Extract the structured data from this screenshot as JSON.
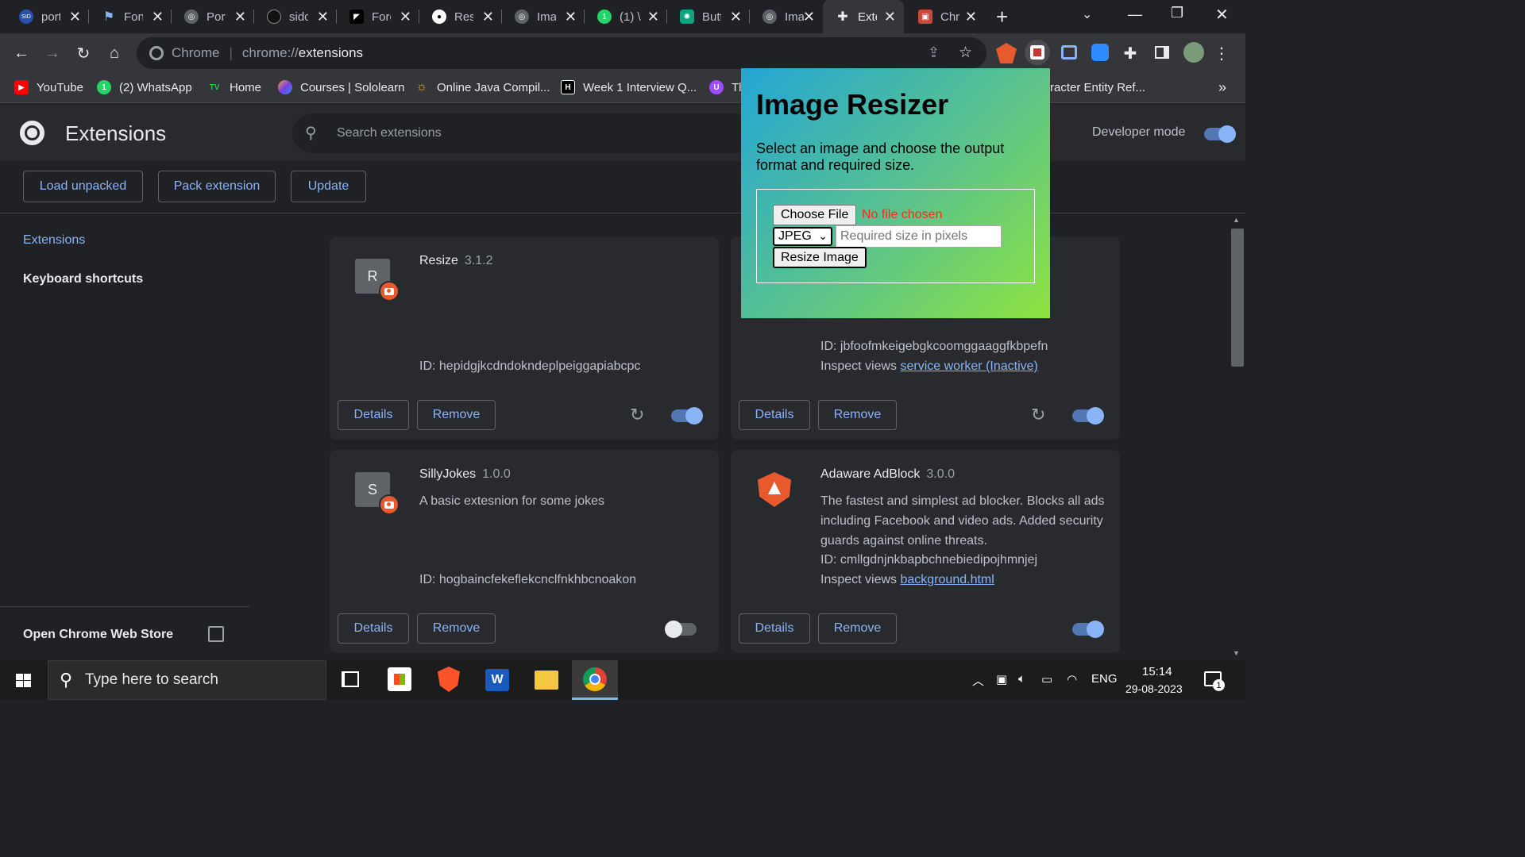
{
  "tabs": [
    {
      "label": "port",
      "fav": "SID",
      "favcolor": "#2a4fb0"
    },
    {
      "label": "Fon",
      "fav": "⚑",
      "favcolor": "#3c6fd8"
    },
    {
      "label": "Port",
      "fav": "◎",
      "favcolor": "#5f6368"
    },
    {
      "label": "sidc",
      "fav": "●",
      "favcolor": "#333333"
    },
    {
      "label": "Fore",
      "fav": "⬢",
      "favcolor": "#000000"
    },
    {
      "label": "Resi",
      "fav": "●",
      "favcolor": "#333333"
    },
    {
      "label": "Ima",
      "fav": "◎",
      "favcolor": "#5f6368"
    },
    {
      "label": "(1) \\",
      "fav": "1",
      "favcolor": "#25d366"
    },
    {
      "label": "Butt",
      "fav": "✺",
      "favcolor": "#10a37f"
    },
    {
      "label": "Ima",
      "fav": "◎",
      "favcolor": "#5f6368"
    },
    {
      "label": "Exte",
      "fav": "✚",
      "favcolor": "#35363a"
    },
    {
      "label": "Chr",
      "fav": "▣",
      "favcolor": "#c94a3d"
    }
  ],
  "omnibox": {
    "chip": "Chrome",
    "url_scheme": "chrome://",
    "url_path": "extensions"
  },
  "bookmarks": [
    {
      "label": "YouTube",
      "fav": "▶",
      "color": "#ff0000"
    },
    {
      "label": "(2) WhatsApp",
      "fav": "1",
      "color": "#25d366"
    },
    {
      "label": "Home",
      "fav": "TV",
      "color": "#2a9d4b"
    },
    {
      "label": "Courses | Sololearn",
      "fav": "S",
      "color": "#7b3fe4"
    },
    {
      "label": "Online Java Compil...",
      "fav": "☼",
      "color": "#e8a33d"
    },
    {
      "label": "Week 1 Interview Q...",
      "fav": "H",
      "color": "#111111"
    },
    {
      "label": "Tl",
      "fav": "U",
      "color": "#9b4dff"
    },
    {
      "label": "racter Entity Ref...",
      "fav": "",
      "color": "#35363a"
    }
  ],
  "header": {
    "title": "Extensions",
    "search_placeholder": "Search extensions",
    "dev_mode_label": "Developer mode",
    "dev_mode_on": true
  },
  "dev_buttons": {
    "load_unpacked": "Load unpacked",
    "pack": "Pack extension",
    "update": "Update"
  },
  "sidebar": {
    "extensions": "Extensions",
    "shortcuts": "Keyboard shortcuts",
    "web_store": "Open Chrome Web Store"
  },
  "cards": [
    {
      "letter": "R",
      "name": "Resize",
      "version": "3.1.2",
      "description": "",
      "id": "ID: hepidgjkcdndokndeplpeiggapiabcpc",
      "inspect_label": "",
      "inspect_link": "",
      "details": "Details",
      "remove": "Remove",
      "enabled": true
    },
    {
      "letter": "",
      "name": "",
      "version": "",
      "description": "",
      "id": "ID: jbfoofmkeigebgkcoomggaaggfkbpefn",
      "inspect_label": "Inspect views",
      "inspect_link": "service worker (Inactive)",
      "details": "Details",
      "remove": "Remove",
      "enabled": true
    },
    {
      "letter": "S",
      "name": "SillyJokes",
      "version": "1.0.0",
      "description": "A basic extesnion for some jokes",
      "id": "ID: hogbaincfekeflekcnclfnkhbcnoakon",
      "inspect_label": "",
      "inspect_link": "",
      "details": "Details",
      "remove": "Remove",
      "enabled": false
    },
    {
      "letter": "",
      "name": "Adaware AdBlock",
      "version": "3.0.0",
      "description": "The fastest and simplest ad blocker. Blocks all ads including Facebook and video ads. Added security guards against online threats.",
      "id": "ID: cmllgdnjnkbapbchnebiedipojhmnjej",
      "inspect_label": "Inspect views",
      "inspect_link": "background.html",
      "details": "Details",
      "remove": "Remove",
      "enabled": true
    }
  ],
  "popup": {
    "title": "Image Resizer",
    "description": "Select an image and choose the output format and required size.",
    "choose_file": "Choose File",
    "no_file": "No file chosen",
    "format": "JPEG",
    "size_placeholder": "Required size in pixels",
    "resize_button": "Resize Image"
  },
  "taskbar": {
    "search_placeholder": "Type here to search",
    "lang": "ENG",
    "time": "15:14",
    "date": "29-08-2023",
    "notifications": "1"
  }
}
